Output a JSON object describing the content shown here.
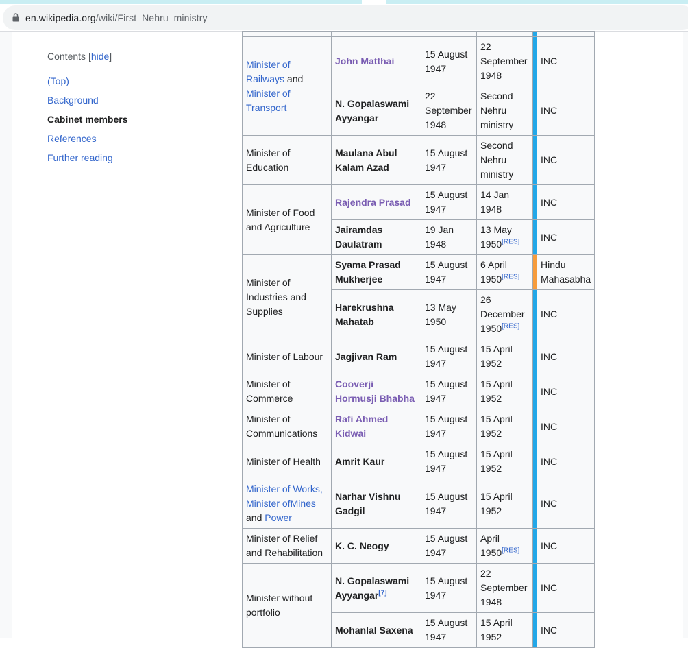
{
  "browser": {
    "url_host": "en.wikipedia.org",
    "url_path": "/wiki/First_Nehru_ministry"
  },
  "toc": {
    "title": "Contents",
    "hide_open": "[",
    "hide_label": "hide",
    "hide_close": "]",
    "items": [
      "(Top)",
      "Background",
      "Cabinet members",
      "References",
      "Further reading"
    ]
  },
  "colors": {
    "inc": "#22a7e8",
    "hindu_mahasabha": "#f79c3c",
    "link": "#3366cc",
    "visited_link": "#795cb2"
  },
  "table": {
    "rows": [
      {
        "portfolio": "",
        "minister": "",
        "from": "",
        "to": "",
        "party": ""
      },
      {
        "portfolio_parts": [
          "Minister of Railways",
          " and ",
          "Minister of Transport"
        ],
        "minister": "John Matthai",
        "from": "15 August 1947",
        "to": "22 September 1948",
        "party": "INC"
      },
      {
        "minister": "N. Gopalaswami Ayyangar",
        "from": "22 September 1948",
        "to": "Second Nehru ministry",
        "party": "INC"
      },
      {
        "portfolio": "Minister of Education",
        "minister": "Maulana Abul Kalam Azad",
        "from": "15 August 1947",
        "to": "Second Nehru ministry",
        "party": "INC"
      },
      {
        "portfolio": "Minister of Food and Agriculture",
        "minister": "Rajendra Prasad",
        "from": "15 August 1947",
        "to": "14 Jan 1948",
        "party": "INC"
      },
      {
        "minister": "Jairamdas Daulatram",
        "from": "19 Jan 1948",
        "to": "13 May 1950",
        "to_note": "[RES]",
        "party": "INC"
      },
      {
        "portfolio": "Minister of Industries and Supplies",
        "minister": "Syama Prasad Mukherjee",
        "from": "15 August 1947",
        "to": "6 April 1950",
        "to_note": "[RES]",
        "party": "Hindu Mahasabha"
      },
      {
        "minister": "Harekrushna Mahatab",
        "from": "13 May 1950",
        "to": "26 December 1950",
        "to_note": "[RES]",
        "party": "INC"
      },
      {
        "portfolio": "Minister of Labour",
        "minister": "Jagjivan Ram",
        "from": "15 August 1947",
        "to": "15 April 1952",
        "party": "INC"
      },
      {
        "portfolio": "Minister of Commerce",
        "minister": "Cooverji Hormusji Bhabha",
        "from": "15 August 1947",
        "to": "15 April 1952",
        "party": "INC"
      },
      {
        "portfolio": "Minister of Communications",
        "minister": "Rafi Ahmed Kidwai",
        "from": "15 August 1947",
        "to": "15 April 1952",
        "party": "INC"
      },
      {
        "portfolio": "Minister of Health",
        "minister": "Amrit Kaur",
        "from": "15 August 1947",
        "to": "15 April 1952",
        "party": "INC"
      },
      {
        "portfolio_parts": [
          "Minister of Works, Minister ofMines",
          " and ",
          "Power"
        ],
        "minister": "Narhar Vishnu Gadgil",
        "from": "15 August 1947",
        "to": "15 April 1952",
        "party": "INC"
      },
      {
        "portfolio": "Minister of Relief and Rehabilitation",
        "minister": "K. C. Neogy",
        "from": "15 August 1947",
        "to": "April 1950",
        "to_note": "[RES]",
        "party": "INC"
      },
      {
        "portfolio": "Minister without portfolio",
        "minister": "N. Gopalaswami Ayyangar",
        "minister_note": "[7]",
        "from": "15 August 1947",
        "to": "22 September 1948",
        "party": "INC"
      },
      {
        "minister": "Mohanlal Saxena",
        "from": "15 August 1947",
        "to": "15 April 1952",
        "party": "INC"
      }
    ]
  }
}
